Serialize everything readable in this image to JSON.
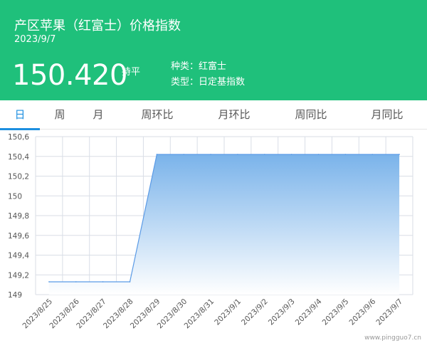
{
  "header": {
    "title": "产区苹果（红富士）价格指数",
    "date": "2023/9/7",
    "value": "150.420",
    "change": "持平",
    "variety": "种类：红富士",
    "type": "类型：日定基指数"
  },
  "tabs": [
    {
      "label": "日",
      "active": true
    },
    {
      "label": "周",
      "active": false
    },
    {
      "label": "月",
      "active": false
    },
    {
      "label": "周环比",
      "active": false
    },
    {
      "label": "月环比",
      "active": false
    },
    {
      "label": "周同比",
      "active": false
    },
    {
      "label": "月同比",
      "active": false
    }
  ],
  "chart_data": {
    "type": "area",
    "x": [
      "2023/8/25",
      "2023/8/26",
      "2023/8/27",
      "2023/8/28",
      "2023/8/29",
      "2023/8/30",
      "2023/8/31",
      "2023/9/1",
      "2023/9/2",
      "2023/9/3",
      "2023/9/4",
      "2023/9/5",
      "2023/9/6",
      "2023/9/7"
    ],
    "values": [
      149.13,
      149.13,
      149.13,
      149.13,
      150.42,
      150.42,
      150.42,
      150.42,
      150.42,
      150.42,
      150.42,
      150.42,
      150.42,
      150.42
    ],
    "ylim": [
      149,
      150.6
    ],
    "yticks": [
      "149",
      "149,2",
      "149,4",
      "149,6",
      "149,8",
      "150",
      "150,2",
      "150,4",
      "150,6"
    ],
    "grid": true,
    "colors": {
      "line": "#5b9be6",
      "fill_top": "#7ab3ea",
      "fill_bottom": "#ffffff",
      "grid": "#d9dee6"
    }
  },
  "watermark": "www.pingguo7.cn"
}
